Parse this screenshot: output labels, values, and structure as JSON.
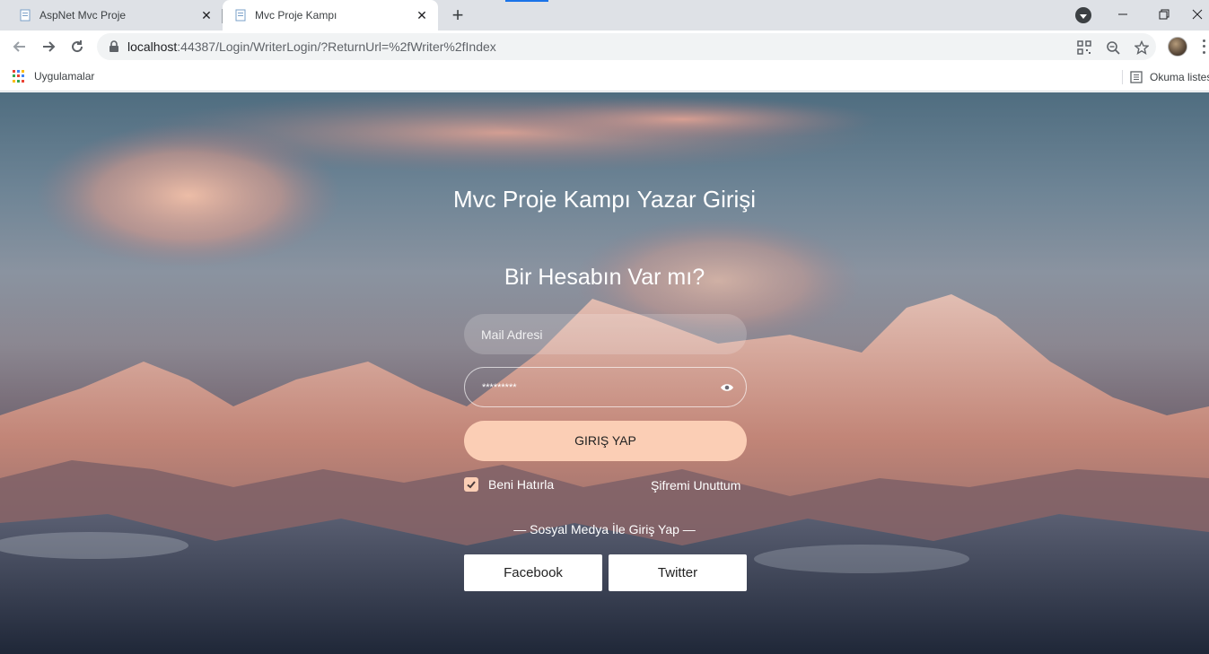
{
  "browser": {
    "tabs": [
      {
        "title": "AspNet Mvc Proje",
        "active": false
      },
      {
        "title": "Mvc Proje Kampı",
        "active": true
      }
    ],
    "new_tab": "+",
    "close_glyph": "✕",
    "url": {
      "host": "localhost",
      "rest": ":44387/Login/WriterLogin/?ReturnUrl=%2fWriter%2fIndex"
    },
    "bookmarks": {
      "apps_label": "Uygulamalar",
      "reading_list_label": "Okuma listesi"
    }
  },
  "login": {
    "title": "Mvc Proje Kampı Yazar Girişi",
    "subtitle": "Bir Hesabın Var mı?",
    "email_placeholder": "Mail Adresi",
    "password_value": "*********",
    "submit_label": "GIRIŞ YAP",
    "remember_label": "Beni Hatırla",
    "remember_checked": true,
    "forgot_label": "Şifremi Unuttum",
    "social_title": "— Sosyal Medya İle Giriş Yap —",
    "facebook_label": "Facebook",
    "twitter_label": "Twitter"
  },
  "colors": {
    "accent": "#fbceb5",
    "tabstrip": "#dee1e6",
    "omnibox": "#f1f3f4",
    "loading_bar": "#1a73e8"
  }
}
